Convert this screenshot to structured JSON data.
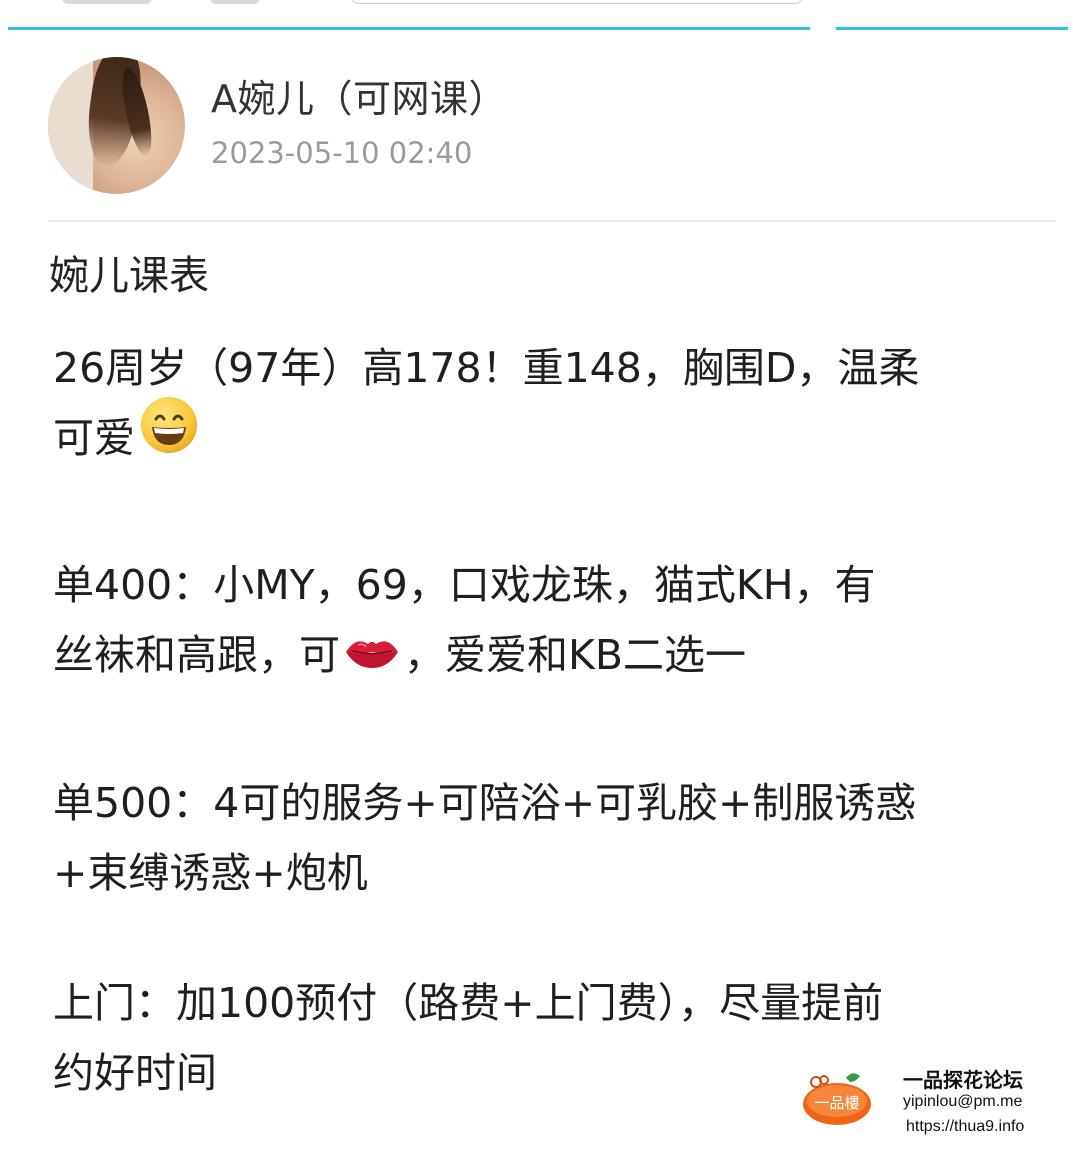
{
  "post": {
    "author": "A婉儿（可网课）",
    "timestamp": "2023-05-10 02:40",
    "title": "婉儿课表",
    "p1_line1": "26周岁（97年）高178！重148，胸围D，温柔",
    "p1_line2": "可爱",
    "p2_line1": "单400：小MY，69，口戏龙珠，猫式KH，有",
    "p2_line2a": "丝袜和高跟，可",
    "p2_line2b": "，爱爱和KB二选一",
    "p3_line1": "单500：4可的服务+可陪浴+可乳胶+制服诱惑",
    "p3_line2": "+束缚诱惑+炮机",
    "p4_line1": "上门：加100预付（路费+上门费），尽量提前",
    "p4_line2": "约好时间"
  },
  "icons": {
    "grin": "grinning-face-emoji",
    "kiss": "kiss-mark-emoji"
  },
  "watermark": {
    "logo_text": "一品樓",
    "title": "一品探花论坛",
    "email": "yipinlou@pm.me",
    "url": "https://thua9.info"
  },
  "colors": {
    "accent_line": "#33c0e4",
    "timestamp": "#9a9a9a",
    "logo_orange": "#f06418"
  }
}
